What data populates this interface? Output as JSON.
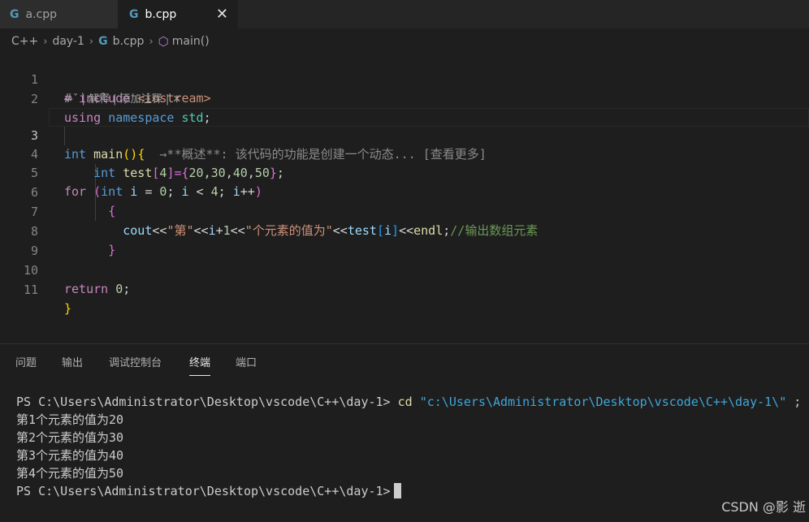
{
  "tabs": [
    {
      "icon": "cpp-file-icon",
      "label": "a.cpp",
      "active": false
    },
    {
      "icon": "cpp-file-icon",
      "label": "b.cpp",
      "active": true,
      "close": "✕"
    }
  ],
  "breadcrumb": {
    "items": [
      "C++",
      "day-1",
      "b.cpp",
      "main()"
    ]
  },
  "code_lens": "⇎ˇ | 解释 | 添加注释 | ✕",
  "code": {
    "line_numbers": [
      "1",
      "2",
      "3",
      "4",
      "5",
      "6",
      "7",
      "8",
      "9",
      "10",
      "11"
    ],
    "l1": {
      "a": "# include ",
      "b": "<iostream>"
    },
    "l2": {
      "a": "using",
      "b": "namespace",
      "c": "std",
      "d": ";"
    },
    "l3": {
      "a": "int",
      "b": "main",
      "c": "()",
      "d": "{",
      "hint": "  →**概述**: 该代码的功能是创建一个动态... [查看更多]"
    },
    "l4": {
      "a": "int",
      "b": "test",
      "c": "[",
      "d": "4",
      "e": "]=",
      "f": "{",
      "g": "20",
      "h": ",",
      "i": "30",
      "j": ",",
      "k": "40",
      "l": ",",
      "m": "50",
      "n": "}",
      "o": ";"
    },
    "l5": {
      "a": "for",
      "b": "(",
      "c": "int",
      "d": "i",
      "e": " = ",
      "f": "0",
      "g": "; ",
      "h": "i",
      "i": " < ",
      "j": "4",
      "k": "; ",
      "l": "i",
      "m": "++",
      "n": ")"
    },
    "l6": {
      "a": "{"
    },
    "l7": {
      "a": "cout",
      "b": "<<",
      "c": "\"第\"",
      "d": "<<",
      "e": "i",
      "f": "+",
      "g": "1",
      "h": "<<",
      "i": "\"个元素的值为\"",
      "j": "<<",
      "k": "test",
      "l": "[",
      "m": "i",
      "n": "]",
      "o": "<<",
      "p": "endl",
      "q": ";",
      "r": "//输出数组元素"
    },
    "l8": {
      "a": "}"
    },
    "l10": {
      "a": "return",
      "b": " ",
      "c": "0",
      "d": ";"
    },
    "l11": {
      "a": "}"
    }
  },
  "panel": {
    "tabs": [
      "问题",
      "输出",
      "调试控制台",
      "终端",
      "端口"
    ],
    "active_tab": "终端"
  },
  "terminal": {
    "prompt": "PS C:\\Users\\Administrator\\Desktop\\vscode\\C++\\day-1> ",
    "cmd": "cd",
    "cmd_arg": " \"c:\\Users\\Administrator\\Desktop\\vscode\\C++\\day-1\\\"",
    "cmd_rest": " ; i",
    "outputs": [
      "第1个元素的值为20",
      "第2个元素的值为30",
      "第3个元素的值为40",
      "第4个元素的值为50"
    ],
    "final_prompt": "PS C:\\Users\\Administrator\\Desktop\\vscode\\C++\\day-1>"
  },
  "watermark": "CSDN @影 逝",
  "colors": {
    "editor_bg": "#1e1e1e",
    "keyword": "#569cd6",
    "function": "#dcdcaa",
    "number": "#b5cea8",
    "string": "#ce9178",
    "comment": "#6a9955"
  }
}
